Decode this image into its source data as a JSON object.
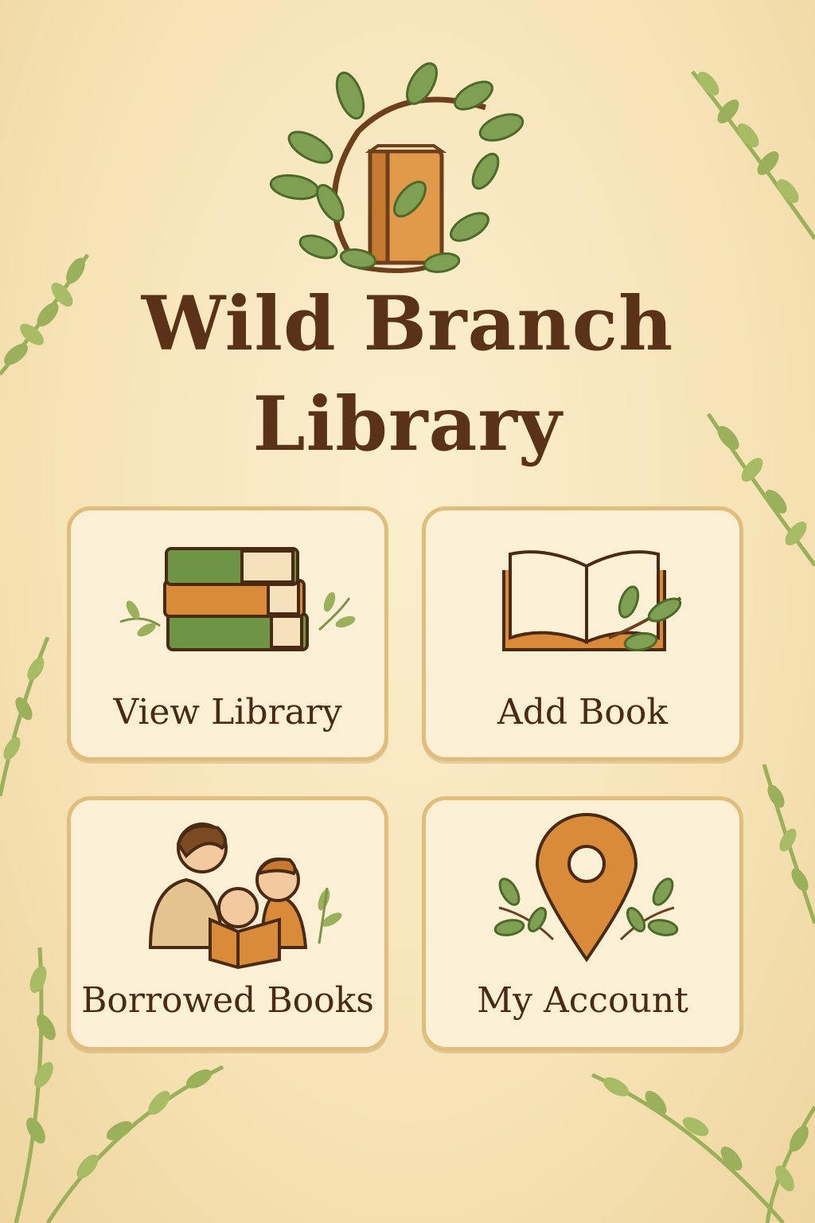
{
  "app": {
    "title_line1": "Wild Branch",
    "title_line2": "Library",
    "logo_icon": "book-with-branch-icon"
  },
  "menu": [
    {
      "id": "view-library",
      "label": "View Library",
      "icon": "book-stack-icon"
    },
    {
      "id": "add-book",
      "label": "Add Book",
      "icon": "open-book-icon"
    },
    {
      "id": "borrowed-books",
      "label": "Borrowed Books",
      "icon": "family-reading-icon"
    },
    {
      "id": "my-account",
      "label": "My Account",
      "icon": "location-pin-icon"
    }
  ],
  "colors": {
    "background": "#f6e3b6",
    "title": "#5a3218",
    "card_fill": "#fbf0d6",
    "card_border": "#e0bd7b",
    "leaf_green": "#7fa052",
    "accent_orange": "#d98b3a",
    "book_green": "#5f8a3e"
  }
}
